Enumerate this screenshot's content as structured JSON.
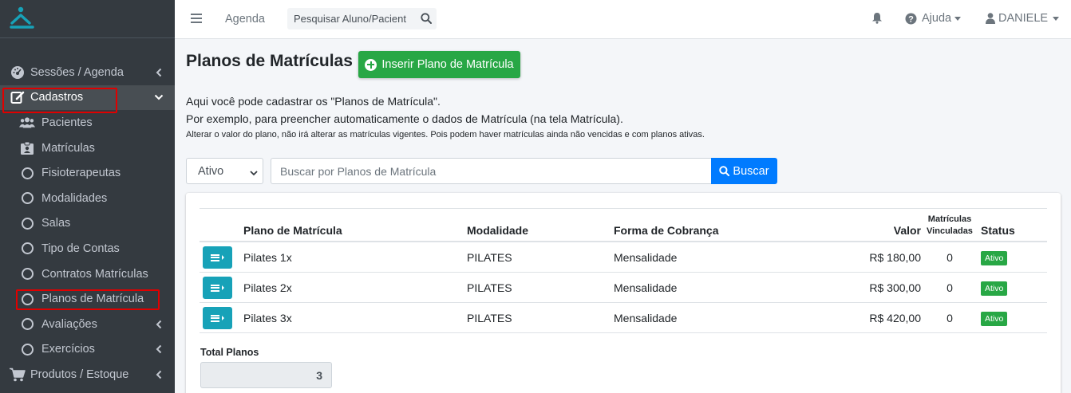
{
  "colors": {
    "sidebar_bg": "#343a40",
    "green": "#28a745",
    "blue": "#007bff",
    "teal": "#17a2b8",
    "highlight": "#e00000"
  },
  "sidebar": {
    "items": [
      {
        "label": "Sessões / Agenda",
        "icon": "tachometer-icon",
        "expandable": true
      },
      {
        "label": "Cadastros",
        "icon": "edit-icon",
        "expanded": true,
        "active": true
      },
      {
        "label": "Pacientes",
        "icon": "users-icon"
      },
      {
        "label": "Matrículas",
        "icon": "id-badge-icon"
      },
      {
        "label": "Fisioterapeutas",
        "icon": "circle-icon"
      },
      {
        "label": "Modalidades",
        "icon": "circle-icon"
      },
      {
        "label": "Salas",
        "icon": "circle-icon"
      },
      {
        "label": "Tipo de Contas",
        "icon": "circle-icon"
      },
      {
        "label": "Contratos Matrículas",
        "icon": "circle-icon"
      },
      {
        "label": "Planos de Matrícula",
        "icon": "circle-icon"
      },
      {
        "label": "Avaliações",
        "icon": "circle-icon",
        "expandable": true
      },
      {
        "label": "Exercícios",
        "icon": "circle-icon",
        "expandable": true
      },
      {
        "label": "Produtos / Estoque",
        "icon": "cart-icon",
        "expandable": true
      }
    ]
  },
  "topbar": {
    "agenda_label": "Agenda",
    "search_placeholder": "Pesquisar Aluno/Pacient",
    "help_label": "Ajuda",
    "user_label": "DANIELE"
  },
  "main": {
    "title": "Planos de Matrículas",
    "insert_button": "Inserir Plano de Matrícula",
    "description_line1": "Aqui você pode cadastrar os \"Planos de Matrícula\".",
    "description_line2": "Por exemplo, para preencher automaticamente o dados de Matrícula (na tela Matrícula).",
    "description_note": "Alterar o valor do plano, não irá alterar as matrículas vigentes. Pois podem haver matrículas ainda não vencidas e com planos ativas.",
    "status_filter": "Ativo",
    "search_placeholder": "Buscar por Planos de Matrícula",
    "search_button": "Buscar",
    "table": {
      "headers": {
        "plan": "Plano de Matrícula",
        "modality": "Modalidade",
        "billing": "Forma de Cobrança",
        "value": "Valor",
        "linked_line1": "Matrículas",
        "linked_line2": "Vinculadas",
        "status": "Status"
      },
      "rows": [
        {
          "plan": "Pilates 1x",
          "modality": "PILATES",
          "billing": "Mensalidade",
          "value": "R$ 180,00",
          "linked": "0",
          "status": "Ativo"
        },
        {
          "plan": "Pilates 2x",
          "modality": "PILATES",
          "billing": "Mensalidade",
          "value": "R$ 300,00",
          "linked": "0",
          "status": "Ativo"
        },
        {
          "plan": "Pilates 3x",
          "modality": "PILATES",
          "billing": "Mensalidade",
          "value": "R$ 420,00",
          "linked": "0",
          "status": "Ativo"
        }
      ]
    },
    "total_label": "Total Planos",
    "total_value": "3"
  }
}
